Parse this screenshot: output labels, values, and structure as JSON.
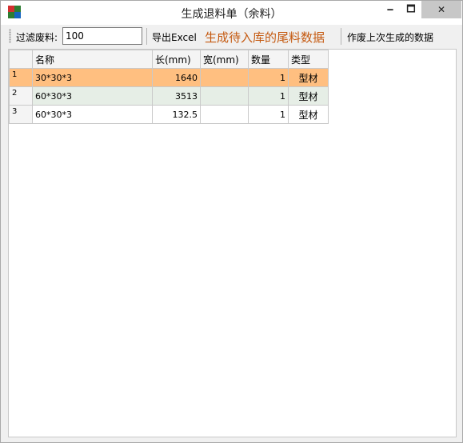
{
  "window": {
    "title": "生成退料单（余料）",
    "controls": {
      "minimize": "🗕",
      "maximize": "🗖",
      "close": "✕"
    }
  },
  "toolbar": {
    "filter_label": "过滤废料:",
    "filter_value": "100",
    "export_label": "导出Excel",
    "generate_label": "生成待入库的尾料数据",
    "void_label": "作废上次生成的数据",
    "generate_color": "#c55a11"
  },
  "grid": {
    "columns": [
      "名称",
      "长(mm)",
      "宽(mm)",
      "数量",
      "类型"
    ],
    "rows": [
      {
        "index": "1",
        "name": "30*30*3",
        "length": "1640",
        "width": "",
        "qty": "1",
        "type": "型材",
        "selected": true
      },
      {
        "index": "2",
        "name": "60*30*3",
        "length": "3513",
        "width": "",
        "qty": "1",
        "type": "型材",
        "selected": false
      },
      {
        "index": "3",
        "name": "60*30*3",
        "length": "132.5",
        "width": "",
        "qty": "1",
        "type": "型材",
        "selected": false
      }
    ],
    "selected_color": "#ffbf80",
    "alt_row_color": "#e6eee6"
  }
}
